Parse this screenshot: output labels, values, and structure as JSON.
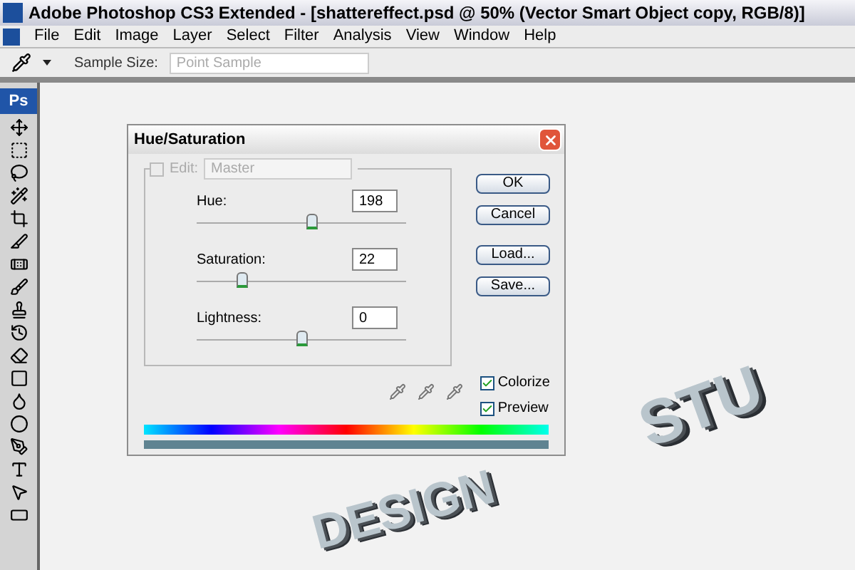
{
  "window": {
    "title": "Adobe Photoshop CS3 Extended - [shattereffect.psd @ 50% (Vector Smart Object copy, RGB/8)]"
  },
  "menu": [
    "File",
    "Edit",
    "Image",
    "Layer",
    "Select",
    "Filter",
    "Analysis",
    "View",
    "Window",
    "Help"
  ],
  "options_bar": {
    "label": "Sample Size:",
    "dropdown": {
      "value": "Point Sample",
      "disabled": true
    }
  },
  "toolbox": {
    "logo": "Ps"
  },
  "canvas": {
    "texts": [
      "DESIGN",
      "STU"
    ]
  },
  "dialog": {
    "title": "Hue/Saturation",
    "edit": {
      "checked": false,
      "label": "Edit:",
      "value": "Master",
      "disabled": true
    },
    "sliders": [
      {
        "label": "Hue:",
        "value": "198",
        "level": 0.55
      },
      {
        "label": "Saturation:",
        "value": "22",
        "level": 0.22
      },
      {
        "label": "Lightness:",
        "value": "0",
        "level": 0.5
      }
    ],
    "buttons": [
      "OK",
      "Cancel",
      "Load...",
      "Save..."
    ],
    "checkboxes": [
      {
        "label": "Colorize",
        "checked": true
      },
      {
        "label": "Preview",
        "checked": true
      }
    ]
  }
}
